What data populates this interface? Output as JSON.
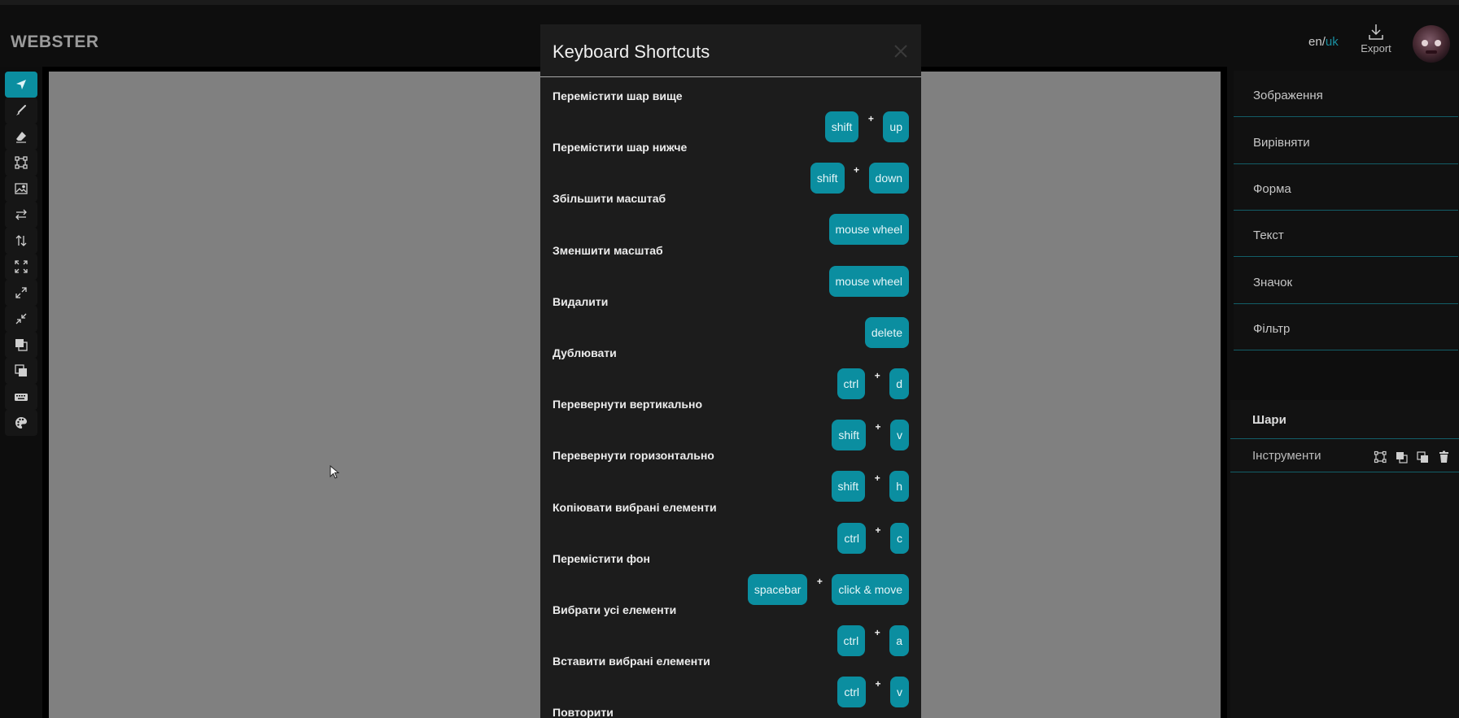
{
  "app": {
    "logo": "WEBSTER"
  },
  "header": {
    "lang_en": "en",
    "lang_sep": "/",
    "lang_uk": "uk",
    "export_label": "Export"
  },
  "colors": {
    "accent": "#0b8ea0",
    "canvas": "#808080",
    "panel": "#0e0e0e",
    "modal": "#1c1c1c"
  },
  "toolbar": {
    "tools": [
      {
        "icon": "select-arrow-icon",
        "active": true
      },
      {
        "icon": "brush-icon"
      },
      {
        "icon": "eraser-icon"
      },
      {
        "icon": "shape-nodes-icon"
      },
      {
        "icon": "image-icon"
      },
      {
        "icon": "flip-horizontal-icon"
      },
      {
        "icon": "flip-vertical-icon"
      },
      {
        "icon": "fit-screen-icon"
      },
      {
        "icon": "expand-icon"
      },
      {
        "icon": "shrink-icon"
      },
      {
        "icon": "bring-forward-icon"
      },
      {
        "icon": "send-backward-icon"
      },
      {
        "icon": "keyboard-icon"
      },
      {
        "icon": "palette-icon"
      }
    ]
  },
  "right_panel": {
    "sections": [
      "Зображення",
      "Вирівняти",
      "Форма",
      "Текст",
      "Значок",
      "Фільтр"
    ],
    "layers_title": "Шари",
    "layer_name": "Інструменти"
  },
  "modal": {
    "title": "Keyboard Shortcuts",
    "shortcuts": [
      {
        "label": "Перемістити шар вище",
        "keys": [
          "shift",
          "up"
        ]
      },
      {
        "label": "Перемістити шар нижче",
        "keys": [
          "shift",
          "down"
        ]
      },
      {
        "label": "Збільшити масштаб",
        "keys": [
          "mouse wheel"
        ]
      },
      {
        "label": "Зменшити масштаб",
        "keys": [
          "mouse wheel"
        ]
      },
      {
        "label": "Видалити",
        "keys": [
          "delete"
        ]
      },
      {
        "label": "Дублювати",
        "keys": [
          "ctrl",
          "d"
        ]
      },
      {
        "label": "Перевернути вертикально",
        "keys": [
          "shift",
          "v"
        ]
      },
      {
        "label": "Перевернути горизонтально",
        "keys": [
          "shift",
          "h"
        ]
      },
      {
        "label": "Копіювати вибрані елементи",
        "keys": [
          "ctrl",
          "c"
        ]
      },
      {
        "label": "Перемістити фон",
        "keys": [
          "spacebar",
          "click & move"
        ]
      },
      {
        "label": "Вибрати усі елементи",
        "keys": [
          "ctrl",
          "a"
        ]
      },
      {
        "label": "Вставити вибрані елементи",
        "keys": [
          "ctrl",
          "v"
        ]
      },
      {
        "label": "Повторити",
        "keys": []
      }
    ],
    "plus_sign": "+"
  }
}
